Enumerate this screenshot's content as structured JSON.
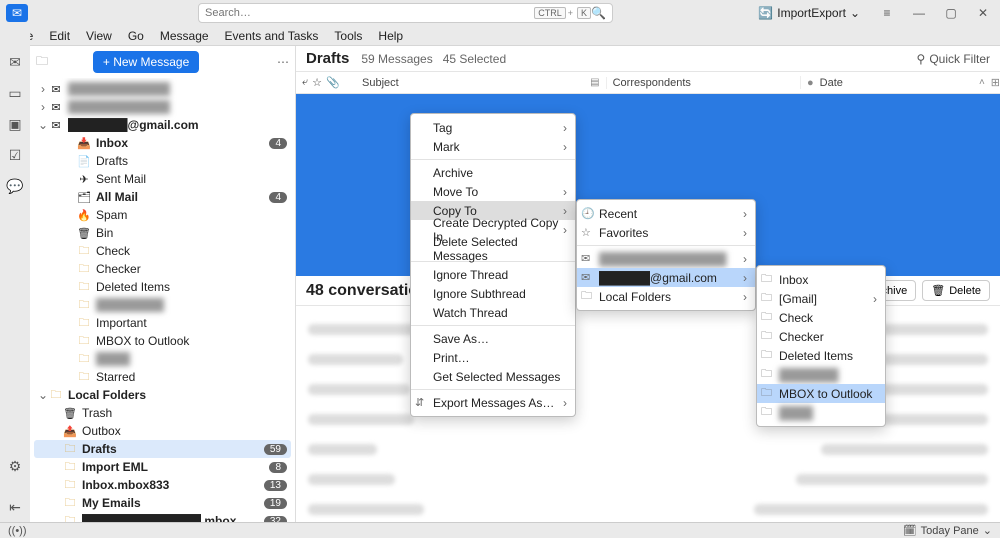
{
  "titlebar": {
    "search_placeholder": "Search…",
    "kbd1": "CTRL",
    "kbd2": "K",
    "import_export": "ImportExport"
  },
  "menu": [
    "File",
    "Edit",
    "View",
    "Go",
    "Message",
    "Events and Tasks",
    "Tools",
    "Help"
  ],
  "sidebar": {
    "new_message": "+  New Message",
    "accounts": [
      {
        "exp": "›",
        "label": "████████████",
        "blur": true
      },
      {
        "exp": "›",
        "label": "████████████",
        "blur": true
      },
      {
        "exp": "⌄",
        "label": "███████@gmail.com",
        "bold": true
      }
    ],
    "gmail_children": [
      {
        "icon": "inbox",
        "label": "Inbox",
        "bold": true,
        "badge": "4"
      },
      {
        "icon": "draft",
        "label": "Drafts"
      },
      {
        "icon": "sent",
        "label": "Sent Mail"
      },
      {
        "icon": "all",
        "label": "All Mail",
        "bold": true,
        "badge": "4"
      },
      {
        "icon": "spam",
        "label": "Spam"
      },
      {
        "icon": "bin",
        "label": "Bin"
      },
      {
        "icon": "fold",
        "label": "Check"
      },
      {
        "icon": "fold",
        "label": "Checker"
      },
      {
        "icon": "fold",
        "label": "Deleted Items"
      },
      {
        "icon": "fold",
        "label": "████████",
        "blur": true
      },
      {
        "icon": "fold",
        "label": "Important"
      },
      {
        "icon": "fold",
        "label": "MBOX to Outlook"
      },
      {
        "icon": "fold",
        "label": "████",
        "blur": true
      },
      {
        "icon": "fold",
        "label": "Starred"
      }
    ],
    "local_header": "Local Folders",
    "local_children": [
      {
        "icon": "bin",
        "label": "Trash"
      },
      {
        "icon": "out",
        "label": "Outbox"
      },
      {
        "icon": "fold",
        "label": "Drafts",
        "bold": true,
        "badge": "59",
        "sel": true
      },
      {
        "icon": "fold",
        "label": "Import EML",
        "bold": true,
        "badge": "8"
      },
      {
        "icon": "fold",
        "label": "Inbox.mbox833",
        "bold": true,
        "badge": "13"
      },
      {
        "icon": "fold",
        "label": "My Emails",
        "bold": true,
        "badge": "19"
      },
      {
        "icon": "fold",
        "label": "██████████████.mbox",
        "bold": true,
        "badge": "32"
      }
    ]
  },
  "content": {
    "title": "Drafts",
    "count": "59 Messages",
    "selected": "45 Selected",
    "quick_filter": "Quick Filter",
    "cols": {
      "subject": "Subject",
      "corr": "Correspondents",
      "date": "Date"
    },
    "conv_title": "48 conversations",
    "archive": "Archive",
    "delete": "Delete"
  },
  "ctx1": [
    {
      "t": "Tag",
      "a": true
    },
    {
      "t": "Mark",
      "a": true
    },
    {
      "sep": true
    },
    {
      "t": "Archive"
    },
    {
      "t": "Move To",
      "a": true
    },
    {
      "t": "Copy To",
      "a": true,
      "hl": true
    },
    {
      "t": "Create Decrypted Copy In",
      "a": true
    },
    {
      "t": "Delete Selected Messages"
    },
    {
      "sep": true
    },
    {
      "t": "Ignore Thread"
    },
    {
      "t": "Ignore Subthread"
    },
    {
      "t": "Watch Thread"
    },
    {
      "sep": true
    },
    {
      "t": "Save As…"
    },
    {
      "t": "Print…"
    },
    {
      "t": "Get Selected Messages"
    },
    {
      "sep": true
    },
    {
      "t": "Export Messages As…",
      "a": true,
      "icon": true
    }
  ],
  "ctx2": [
    {
      "t": "Recent",
      "a": true,
      "ic": "🕘"
    },
    {
      "t": "Favorites",
      "a": true,
      "ic": "☆"
    },
    {
      "sep": true
    },
    {
      "t": "███████████████",
      "a": true,
      "ic": "✉",
      "blur": true
    },
    {
      "t": "██████@gmail.com",
      "a": true,
      "ic": "✉",
      "hl": true
    },
    {
      "t": "Local Folders",
      "a": true,
      "ic": "🗀"
    }
  ],
  "ctx3": [
    {
      "t": "Inbox",
      "ic": "🗀"
    },
    {
      "t": "[Gmail]",
      "ic": "🗀",
      "a": true
    },
    {
      "t": "Check",
      "ic": "🗀"
    },
    {
      "t": "Checker",
      "ic": "🗀"
    },
    {
      "t": "Deleted Items",
      "ic": "🗀"
    },
    {
      "t": "███████",
      "ic": "🗀",
      "blur": true
    },
    {
      "t": "MBOX to Outlook",
      "ic": "🗀",
      "hl": true
    },
    {
      "t": "████",
      "ic": "🗀",
      "blur": true
    }
  ],
  "status": {
    "today_pane": "Today Pane"
  }
}
